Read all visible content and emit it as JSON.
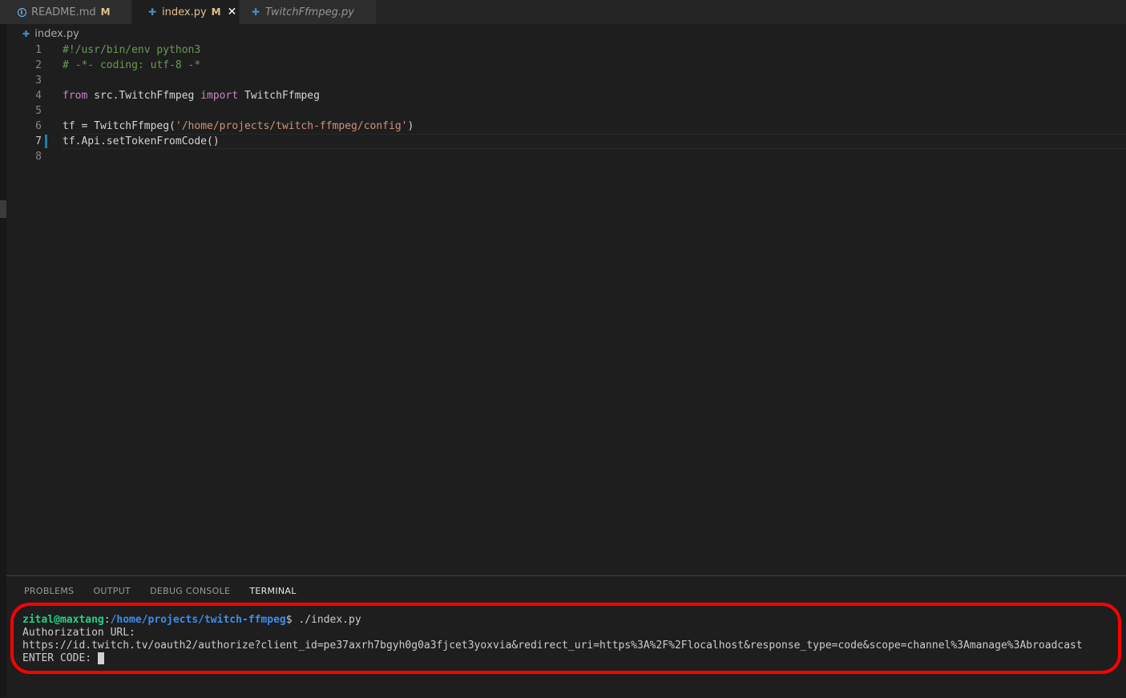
{
  "tabs": [
    {
      "icon": "info-icon",
      "label": "README.md",
      "badge": "M",
      "active": false
    },
    {
      "icon": "python-icon",
      "label": "index.py",
      "badge": "M",
      "active": true,
      "close": "✕"
    },
    {
      "icon": "python-icon",
      "label": "TwitchFfmpeg.py",
      "active": false,
      "italic": true
    }
  ],
  "breadcrumb": {
    "icon": "python-icon",
    "file": "index.py"
  },
  "editor": {
    "current_line": 7,
    "lines": [
      {
        "n": "1",
        "tokens": [
          {
            "t": "#!/usr/bin/env python3",
            "c": "comment"
          }
        ]
      },
      {
        "n": "2",
        "tokens": [
          {
            "t": "# -*- coding: utf-8 -*",
            "c": "comment"
          }
        ]
      },
      {
        "n": "3",
        "tokens": []
      },
      {
        "n": "4",
        "tokens": [
          {
            "t": "from",
            "c": "keyword"
          },
          {
            "t": " src.TwitchFfmpeg ",
            "c": "plain"
          },
          {
            "t": "import",
            "c": "keyword"
          },
          {
            "t": " TwitchFfmpeg",
            "c": "plain"
          }
        ]
      },
      {
        "n": "5",
        "tokens": []
      },
      {
        "n": "6",
        "tokens": [
          {
            "t": "tf = TwitchFfmpeg(",
            "c": "plain"
          },
          {
            "t": "'/home/projects/twitch-ffmpeg/config'",
            "c": "string"
          },
          {
            "t": ")",
            "c": "plain"
          }
        ]
      },
      {
        "n": "7",
        "tokens": [
          {
            "t": "tf.Api.setTokenFromCode()",
            "c": "plain"
          }
        ]
      },
      {
        "n": "8",
        "tokens": []
      }
    ]
  },
  "panel": {
    "tabs": [
      "PROBLEMS",
      "OUTPUT",
      "DEBUG CONSOLE",
      "TERMINAL"
    ],
    "active_tab": "TERMINAL"
  },
  "terminal": {
    "user_host": "zital@maxtang",
    "path_sep": ":",
    "path": "/home/projects/twitch-ffmpeg",
    "prompt_suffix": "$ ./index.py",
    "line2": "Authorization URL:",
    "line3": "https://id.twitch.tv/oauth2/authorize?client_id=pe37axrh7bgyh0g0a3fjcet3yoxvia&redirect_uri=https%3A%2F%2Flocalhost&response_type=code&scope=channel%3Amanage%3Abroadcast",
    "line4": "ENTER CODE: "
  },
  "colors": {
    "highlight_box": "#ff0000",
    "modified_badge": "#e2c08d",
    "terminal_user": "#23d18b",
    "terminal_path": "#3b8eea"
  }
}
